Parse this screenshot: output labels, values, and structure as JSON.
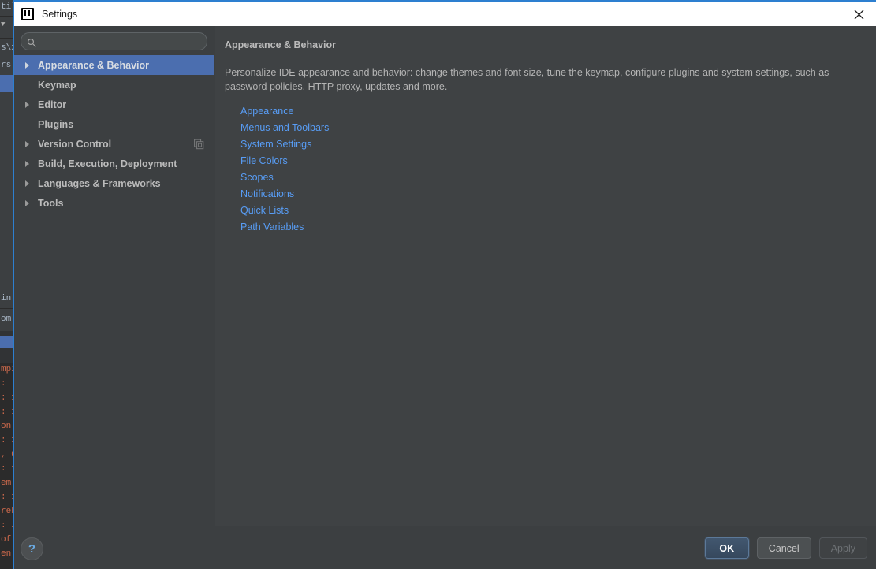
{
  "window": {
    "title": "Settings",
    "app_icon": "intellij-idea-icon",
    "close_icon": "close-icon",
    "accent_color": "#2d7fd0",
    "title_bar_bg": "#ffffff",
    "dialog_bg": "#3c3f41"
  },
  "sidebar": {
    "search": {
      "value": "",
      "placeholder": "",
      "icon": "search-icon"
    },
    "selected_index": 0,
    "selected_color": "#4b6eaf",
    "items": [
      {
        "label": "Appearance & Behavior",
        "expandable": true,
        "selected": true,
        "trailing_icon": ""
      },
      {
        "label": "Keymap",
        "expandable": false,
        "selected": false,
        "trailing_icon": ""
      },
      {
        "label": "Editor",
        "expandable": true,
        "selected": false,
        "trailing_icon": ""
      },
      {
        "label": "Plugins",
        "expandable": false,
        "selected": false,
        "trailing_icon": ""
      },
      {
        "label": "Version Control",
        "expandable": true,
        "selected": false,
        "trailing_icon": "copy-icon"
      },
      {
        "label": "Build, Execution, Deployment",
        "expandable": true,
        "selected": false,
        "trailing_icon": ""
      },
      {
        "label": "Languages & Frameworks",
        "expandable": true,
        "selected": false,
        "trailing_icon": ""
      },
      {
        "label": "Tools",
        "expandable": true,
        "selected": false,
        "trailing_icon": ""
      }
    ]
  },
  "main": {
    "title": "Appearance & Behavior",
    "description": "Personalize IDE appearance and behavior: change themes and font size, tune the keymap, configure plugins and system settings, such as password policies, HTTP proxy, updates and more.",
    "link_color": "#589df6",
    "links": [
      {
        "label": "Appearance"
      },
      {
        "label": "Menus and Toolbars"
      },
      {
        "label": "System Settings"
      },
      {
        "label": "File Colors"
      },
      {
        "label": "Scopes"
      },
      {
        "label": "Notifications"
      },
      {
        "label": "Quick Lists"
      },
      {
        "label": "Path Variables"
      }
    ]
  },
  "footer": {
    "help_label": "?",
    "buttons": [
      {
        "label": "OK",
        "style": "default"
      },
      {
        "label": "Cancel",
        "style": "normal"
      },
      {
        "label": "Apply",
        "style": "disabled"
      }
    ]
  },
  "backdrop": {
    "lines_top": [
      "tils",
      "▼",
      "s\\x",
      "rs"
    ],
    "lines_mid": [
      "in",
      "om"
    ],
    "lines_console": [
      "mpi",
      ": 1",
      ": 1",
      ": 1",
      "on",
      ": 1",
      ", 0",
      ": 1",
      "em",
      ": 1",
      "reb",
      ": 1",
      "of",
      "en"
    ]
  }
}
